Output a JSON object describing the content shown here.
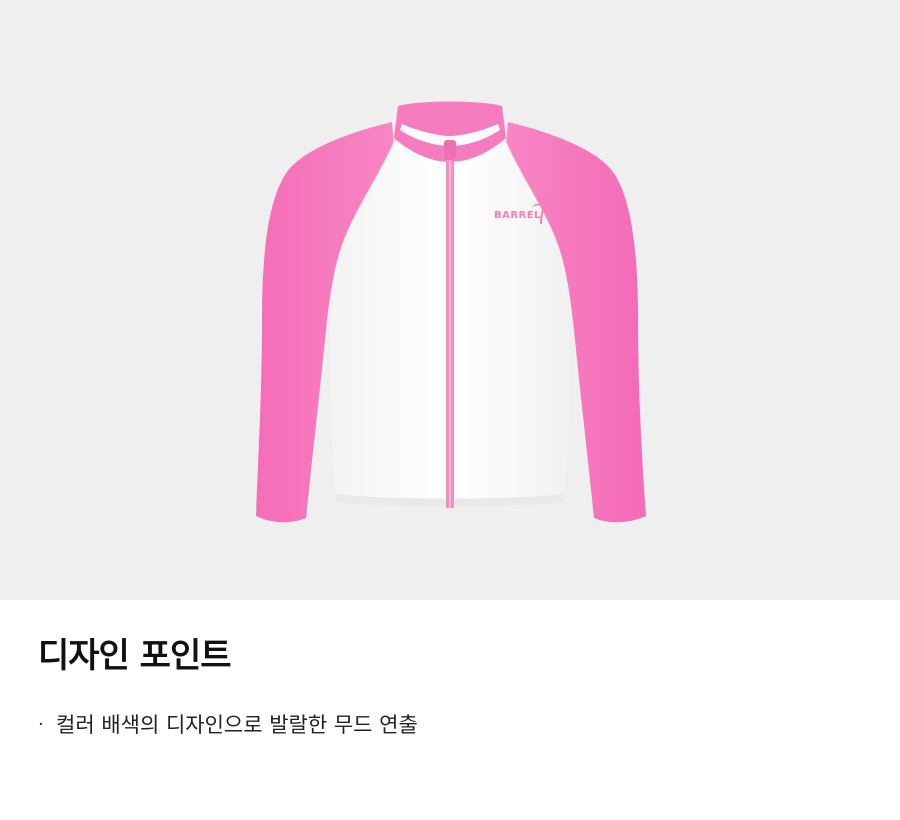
{
  "product": {
    "image_alt": "Pink and white zip-up rash guard",
    "brand_logo": "BARREL",
    "colors": {
      "background": "#efefef",
      "sleeve_pink": "#f77bbf",
      "body_white": "#ffffff",
      "zipper_pink": "#f28fc2",
      "logo_pink": "#f27fb6"
    }
  },
  "design_point": {
    "title": "디자인 포인트",
    "items": [
      {
        "bullet": "·",
        "text": "컬러 배색의 디자인으로 발랄한 무드 연출"
      }
    ]
  }
}
